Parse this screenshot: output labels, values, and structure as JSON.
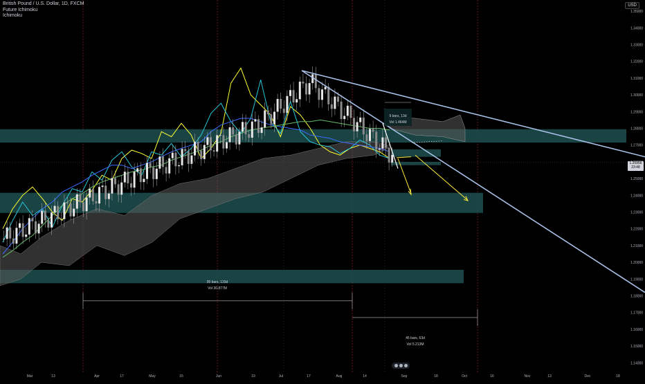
{
  "header": {
    "symbol_title": "British Pound / U.S. Dollar, 1D, FXCM",
    "indicator_1": "Future Ichimoku",
    "indicator_2": "Ichimoku"
  },
  "currency_badge": "USD",
  "last_price": {
    "price": "1.25956",
    "countdown": "23:48"
  },
  "chart_data": {
    "type": "line",
    "y_axis": {
      "ticks": [
        "1.35000",
        "1.34000",
        "1.33000",
        "1.32000",
        "1.31000",
        "1.30000",
        "1.29000",
        "1.28000",
        "1.27000",
        "1.26000",
        "1.25000",
        "1.24000",
        "1.23000",
        "1.22000",
        "1.21000",
        "1.20000",
        "1.19000",
        "1.18000",
        "1.17000",
        "1.16000",
        "1.15000",
        "1.14000"
      ],
      "range": [
        1.136,
        1.355
      ]
    },
    "x_axis": {
      "ticks": [
        "Mar",
        "13",
        "Apr",
        "17",
        "May",
        "15",
        "Jun",
        "19",
        "Jul",
        "17",
        "Aug",
        "14",
        "Sep",
        "18",
        "Oct",
        "16",
        "Nov",
        "13",
        "Dec",
        "18"
      ]
    },
    "zones": [
      {
        "name": "resistance-zone",
        "y_top": 1.2795,
        "y_bottom": 1.2715
      },
      {
        "name": "support-zone",
        "y_top": 1.2415,
        "y_bottom": 1.2295
      },
      {
        "name": "lower-zone",
        "y_top": 1.1955,
        "y_bottom": 1.1875
      },
      {
        "name": "small-zone-upper",
        "y_top": 1.2675,
        "y_bottom": 1.263
      },
      {
        "name": "small-zone-lower",
        "y_top": 1.26,
        "y_bottom": 1.258
      }
    ],
    "trendlines": [
      {
        "name": "upper-trendline",
        "x1": "Jul 14",
        "y1": 1.3145,
        "x2": "Dec 31",
        "y2": 1.263
      },
      {
        "name": "lower-trendline",
        "x1": "Jul 14",
        "y1": 1.3145,
        "x2": "Dec 31",
        "y2": 1.182
      }
    ],
    "measurements": [
      {
        "label": "95 bars, 133d",
        "volume": "Vol 30.877M"
      },
      {
        "label": "45 bars, 63d",
        "volume": "Vol 5.213M"
      },
      {
        "label": "9 bars, 13d",
        "volume": "Vol 1.464M"
      }
    ],
    "series": [
      {
        "name": "",
        "color": "#ffff33",
        "values": [
          1.22,
          1.232,
          1.24,
          1.245,
          1.238,
          1.23,
          1.225,
          1.238,
          1.236,
          1.243,
          1.252,
          1.249,
          1.262,
          1.267,
          1.265,
          1.262,
          1.278,
          1.275,
          1.283,
          1.276,
          1.262,
          1.268,
          1.277,
          1.307,
          1.316,
          1.3,
          1.294,
          1.288,
          1.275,
          1.293,
          1.288,
          1.28,
          1.27,
          1.266,
          1.264,
          1.268,
          1.27,
          1.268,
          1.266,
          1.262
        ]
      },
      {
        "name": "",
        "color": "#26c6da",
        "values": [
          1.212,
          1.225,
          1.236,
          1.228,
          1.232,
          1.221,
          1.234,
          1.244,
          1.242,
          1.254,
          1.249,
          1.261,
          1.266,
          1.257,
          1.252,
          1.266,
          1.264,
          1.271,
          1.263,
          1.268,
          1.276,
          1.289,
          1.295,
          1.284,
          1.277,
          1.286,
          1.309,
          1.284,
          1.277,
          1.296,
          1.278,
          1.272,
          1.27,
          1.269,
          1.265,
          1.268,
          1.273,
          1.27,
          1.264,
          1.262
        ]
      },
      {
        "name": "",
        "color": "#3a6cff",
        "values": [
          1.205,
          1.212,
          1.22,
          1.226,
          1.232,
          1.236,
          1.242,
          1.245,
          1.248,
          1.252,
          1.255,
          1.258,
          1.258,
          1.256,
          1.258,
          1.26,
          1.263,
          1.266,
          1.268,
          1.27,
          1.272,
          1.278,
          1.282,
          1.284,
          1.286,
          1.286,
          1.284,
          1.282,
          1.281,
          1.28,
          1.279,
          1.276,
          1.275,
          1.274,
          1.272,
          1.271,
          1.27,
          1.269,
          1.268,
          1.266
        ]
      },
      {
        "name": "",
        "color": "#66bb6a",
        "values": [
          1.203,
          1.207,
          1.212,
          1.216,
          1.222,
          1.228,
          1.234,
          1.238,
          1.241,
          1.245,
          1.248,
          1.25,
          1.252,
          1.254,
          1.255,
          1.257,
          1.258,
          1.261,
          1.263,
          1.265,
          1.267,
          1.27,
          1.272,
          1.275,
          1.277,
          1.279,
          1.28,
          1.281,
          1.282,
          1.283,
          1.284,
          1.284,
          1.285,
          1.284,
          1.283,
          1.282,
          1.281,
          1.28,
          1.28,
          1.279
        ]
      },
      {
        "name": "",
        "color": "#ff9800",
        "values": []
      }
    ]
  }
}
